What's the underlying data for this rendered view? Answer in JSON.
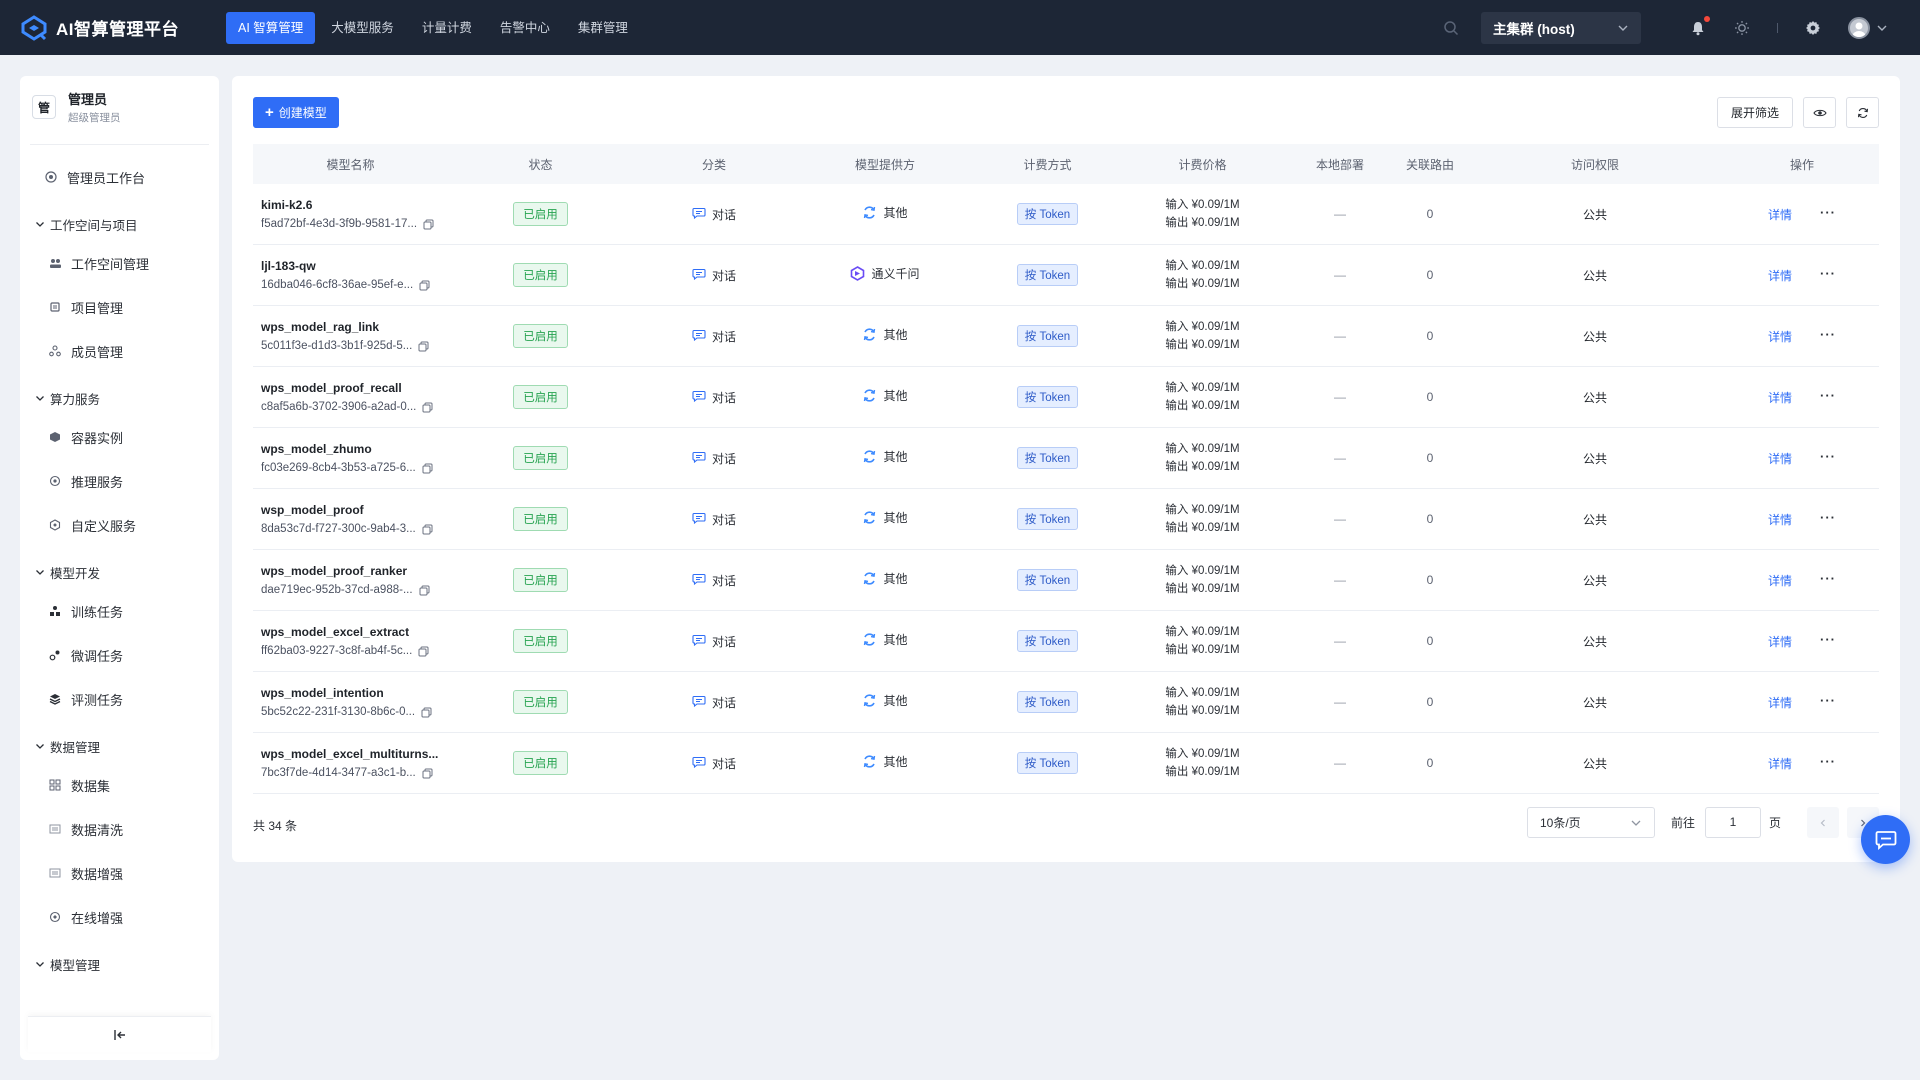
{
  "app": {
    "title": "AI智算管理平台"
  },
  "nav": [
    {
      "label": "AI 智算管理",
      "active": true
    },
    {
      "label": "大模型服务",
      "active": false
    },
    {
      "label": "计量计费",
      "active": false
    },
    {
      "label": "告警中心",
      "active": false
    },
    {
      "label": "集群管理",
      "active": false
    }
  ],
  "cluster": {
    "selected": "主集群 (host)"
  },
  "user": {
    "avatar_initial": "管",
    "name": "管理员",
    "role": "超级管理员"
  },
  "sidebar": {
    "workbench": "管理员工作台",
    "groups": [
      {
        "title": "工作空间与项目",
        "items": [
          "工作空间管理",
          "项目管理",
          "成员管理"
        ]
      },
      {
        "title": "算力服务",
        "items": [
          "容器实例",
          "推理服务",
          "自定义服务"
        ]
      },
      {
        "title": "模型开发",
        "items": [
          "训练任务",
          "微调任务",
          "评测任务"
        ]
      },
      {
        "title": "数据管理",
        "items": [
          "数据集",
          "数据清洗",
          "数据增强",
          "在线增强"
        ]
      },
      {
        "title": "模型管理",
        "items": []
      }
    ]
  },
  "toolbar": {
    "create_label": "创建模型",
    "filter_label": "展开筛选"
  },
  "table": {
    "columns": [
      "模型名称",
      "状态",
      "分类",
      "模型提供方",
      "计费方式",
      "计费价格",
      "本地部署",
      "关联路由",
      "访问权限",
      "操作"
    ],
    "rows": [
      {
        "name": "kimi-k2.6",
        "id": "f5ad72bf-4e3d-3f9b-9581-17...",
        "status": "已启用",
        "category": "对话",
        "provider": "其他",
        "billing": "按 Token",
        "price_in": "输入 ¥0.09/1M",
        "price_out": "输出 ¥0.09/1M",
        "local": "—",
        "routes": "0",
        "access": "公共",
        "detail": "详情"
      },
      {
        "name": "ljl-183-qw",
        "id": "16dba046-6cf8-36ae-95ef-e...",
        "status": "已启用",
        "category": "对话",
        "provider": "通义千问",
        "billing": "按 Token",
        "price_in": "输入 ¥0.09/1M",
        "price_out": "输出 ¥0.09/1M",
        "local": "—",
        "routes": "0",
        "access": "公共",
        "detail": "详情"
      },
      {
        "name": "wps_model_rag_link",
        "id": "5c011f3e-d1d3-3b1f-925d-5...",
        "status": "已启用",
        "category": "对话",
        "provider": "其他",
        "billing": "按 Token",
        "price_in": "输入 ¥0.09/1M",
        "price_out": "输出 ¥0.09/1M",
        "local": "—",
        "routes": "0",
        "access": "公共",
        "detail": "详情"
      },
      {
        "name": "wps_model_proof_recall",
        "id": "c8af5a6b-3702-3906-a2ad-0...",
        "status": "已启用",
        "category": "对话",
        "provider": "其他",
        "billing": "按 Token",
        "price_in": "输入 ¥0.09/1M",
        "price_out": "输出 ¥0.09/1M",
        "local": "—",
        "routes": "0",
        "access": "公共",
        "detail": "详情"
      },
      {
        "name": "wps_model_zhumo",
        "id": "fc03e269-8cb4-3b53-a725-6...",
        "status": "已启用",
        "category": "对话",
        "provider": "其他",
        "billing": "按 Token",
        "price_in": "输入 ¥0.09/1M",
        "price_out": "输出 ¥0.09/1M",
        "local": "—",
        "routes": "0",
        "access": "公共",
        "detail": "详情"
      },
      {
        "name": "wsp_model_proof",
        "id": "8da53c7d-f727-300c-9ab4-3...",
        "status": "已启用",
        "category": "对话",
        "provider": "其他",
        "billing": "按 Token",
        "price_in": "输入 ¥0.09/1M",
        "price_out": "输出 ¥0.09/1M",
        "local": "—",
        "routes": "0",
        "access": "公共",
        "detail": "详情"
      },
      {
        "name": "wps_model_proof_ranker",
        "id": "dae719ec-952b-37cd-a988-...",
        "status": "已启用",
        "category": "对话",
        "provider": "其他",
        "billing": "按 Token",
        "price_in": "输入 ¥0.09/1M",
        "price_out": "输出 ¥0.09/1M",
        "local": "—",
        "routes": "0",
        "access": "公共",
        "detail": "详情"
      },
      {
        "name": "wps_model_excel_extract",
        "id": "ff62ba03-9227-3c8f-ab4f-5c...",
        "status": "已启用",
        "category": "对话",
        "provider": "其他",
        "billing": "按 Token",
        "price_in": "输入 ¥0.09/1M",
        "price_out": "输出 ¥0.09/1M",
        "local": "—",
        "routes": "0",
        "access": "公共",
        "detail": "详情"
      },
      {
        "name": "wps_model_intention",
        "id": "5bc52c22-231f-3130-8b6c-0...",
        "status": "已启用",
        "category": "对话",
        "provider": "其他",
        "billing": "按 Token",
        "price_in": "输入 ¥0.09/1M",
        "price_out": "输出 ¥0.09/1M",
        "local": "—",
        "routes": "0",
        "access": "公共",
        "detail": "详情"
      },
      {
        "name": "wps_model_excel_multiturns...",
        "id": "7bc3f7de-4d14-3477-a3c1-b...",
        "status": "已启用",
        "category": "对话",
        "provider": "其他",
        "billing": "按 Token",
        "price_in": "输入 ¥0.09/1M",
        "price_out": "输出 ¥0.09/1M",
        "local": "—",
        "routes": "0",
        "access": "公共",
        "detail": "详情"
      }
    ]
  },
  "pagination": {
    "total": "共 34 条",
    "page_size": "10条/页",
    "goto_label": "前往",
    "page": "1",
    "page_unit": "页"
  },
  "colors": {
    "accent": "#2f6df6",
    "topbar": "#1d2636",
    "success": "#27a351"
  }
}
